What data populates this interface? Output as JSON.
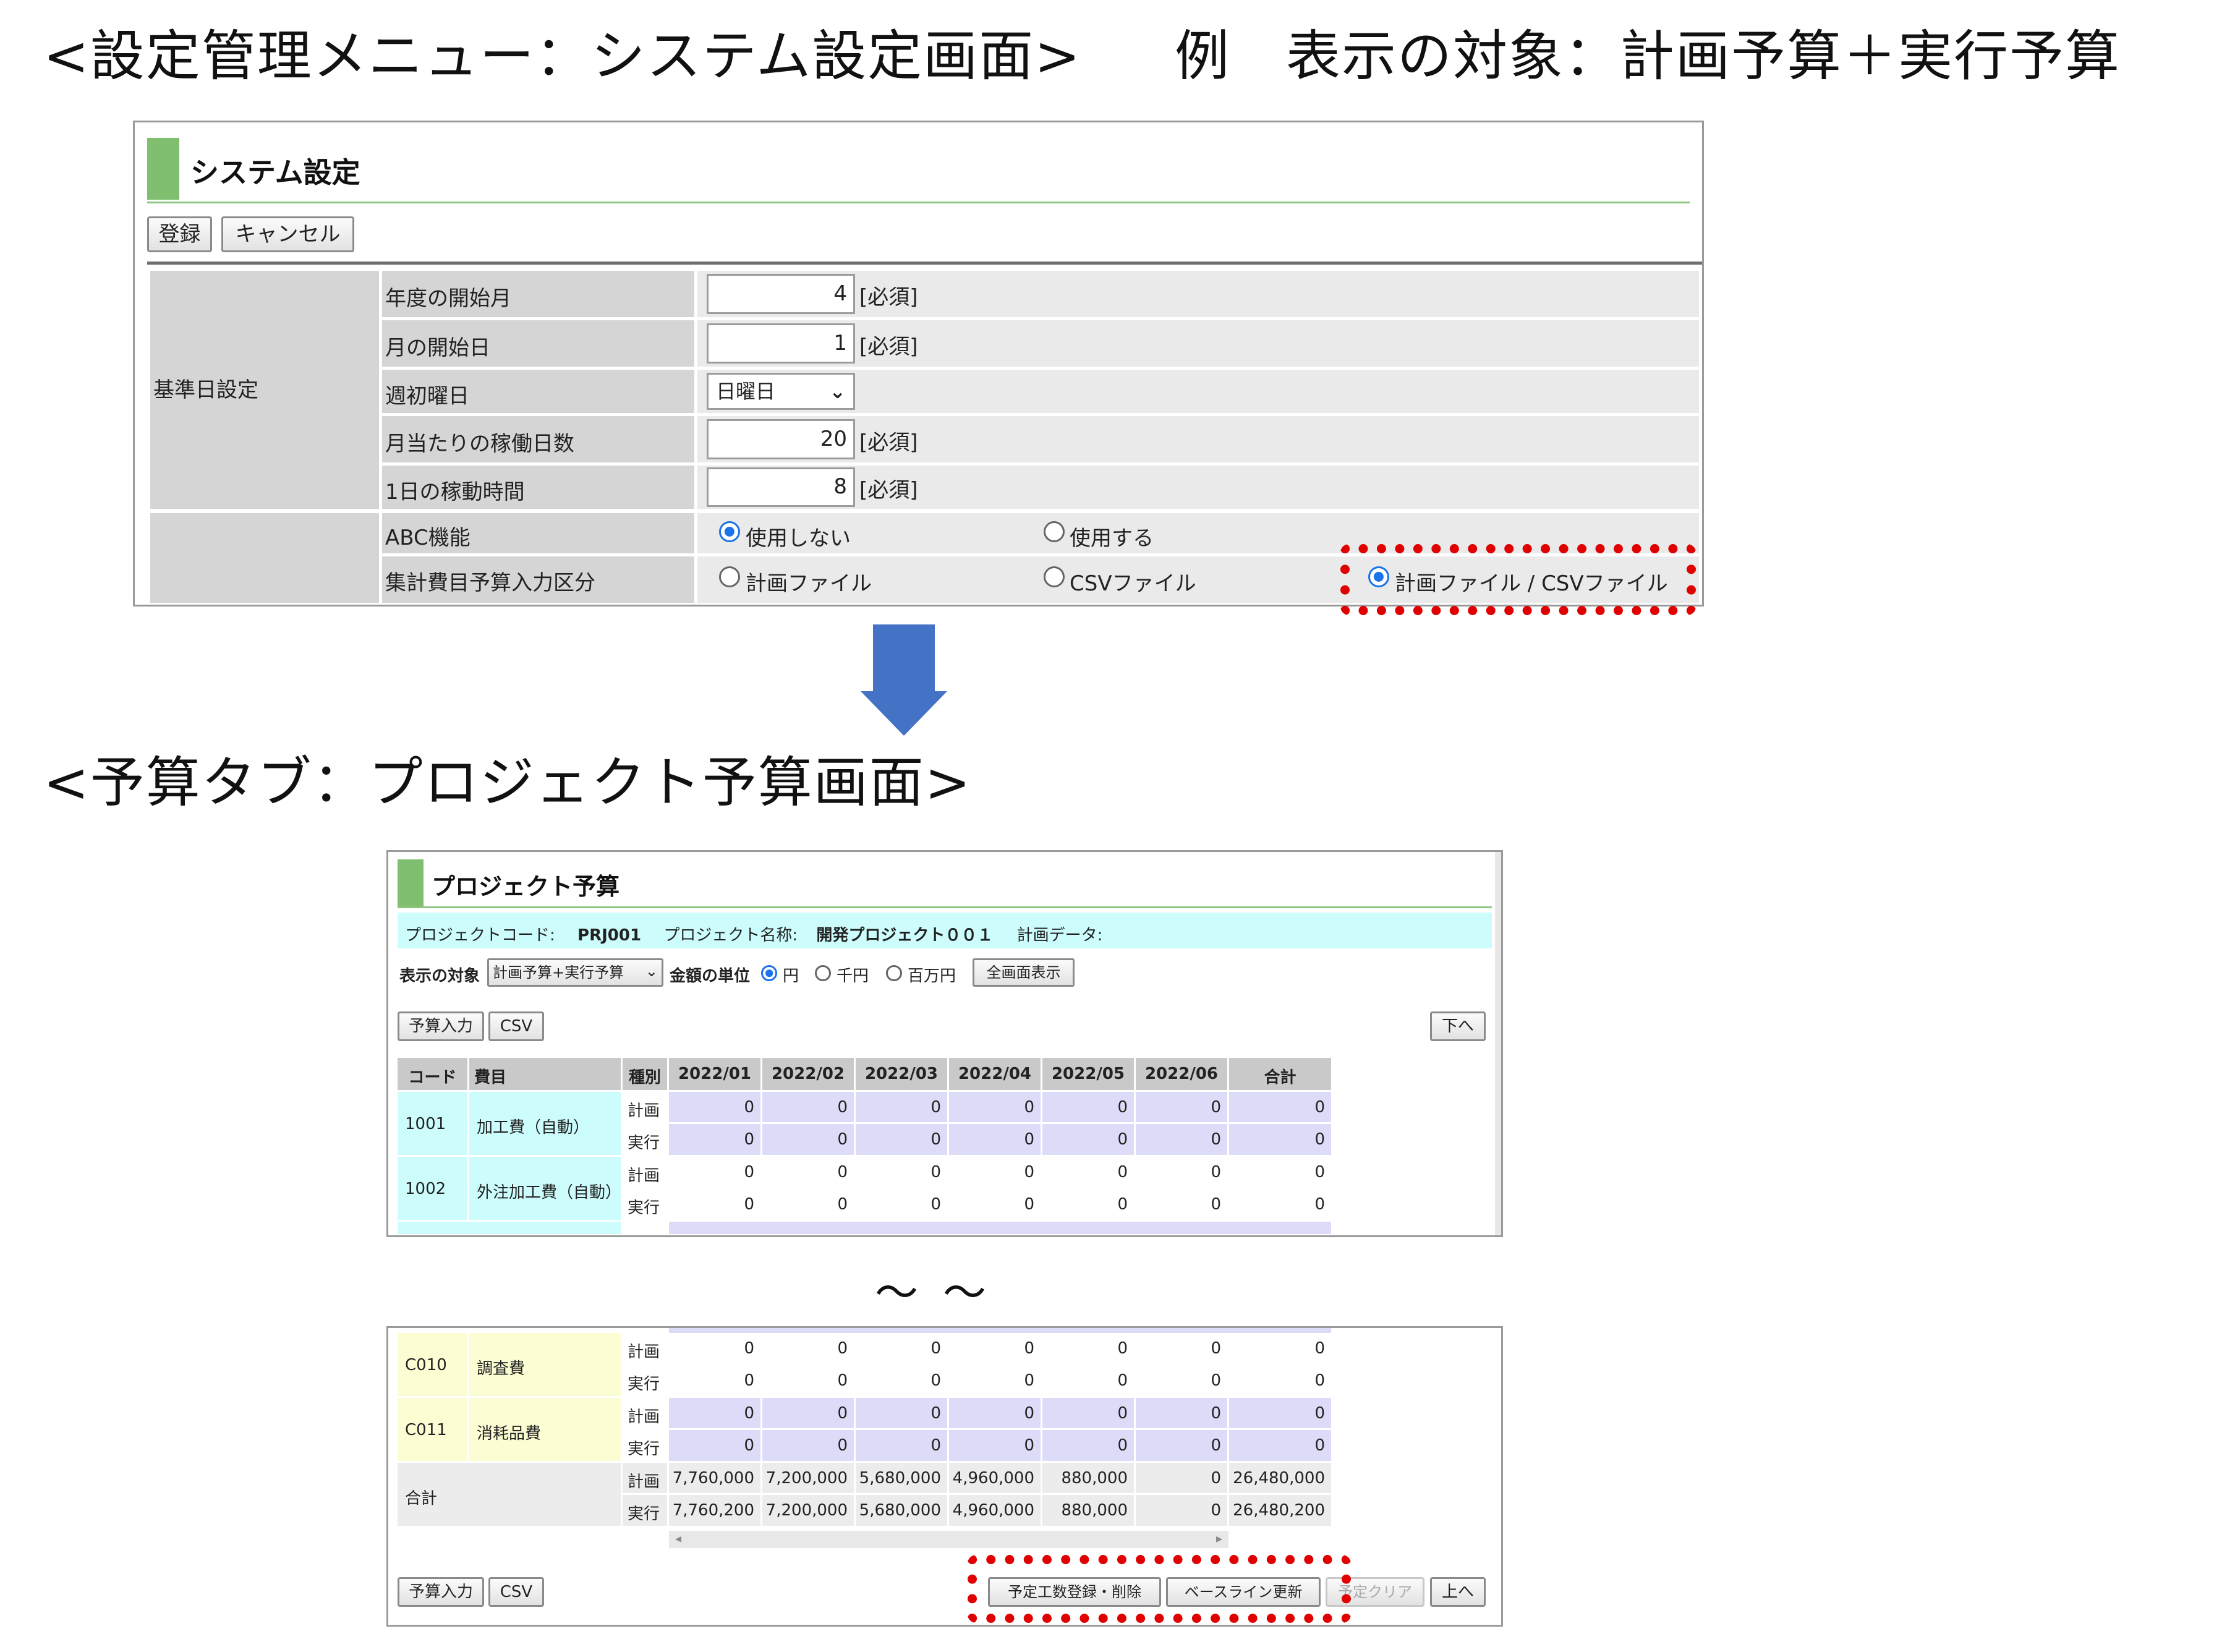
{
  "headings": {
    "system_section": "<設定管理メニュー：システム設定画面>",
    "example": "例　表示の対象：計画予算＋実行予算",
    "budget_section": "<予算タブ：プロジェクト予算画面>"
  },
  "system_settings": {
    "title": "システム設定",
    "buttons": {
      "register": "登録",
      "cancel": "キャンセル"
    },
    "group_label": "基準日設定",
    "required_mark": "[必須]",
    "rows": [
      {
        "label": "年度の開始月",
        "value": "4"
      },
      {
        "label": "月の開始日",
        "value": "1"
      },
      {
        "label": "週初曜日",
        "value": "日曜日"
      },
      {
        "label": "月当たりの稼働日数",
        "value": "20"
      },
      {
        "label": "1日の稼動時間",
        "value": "8"
      }
    ],
    "abc": {
      "label": "ABC機能",
      "options": [
        "使用しない",
        "使用する"
      ],
      "selected": "使用しない"
    },
    "budget_input": {
      "label": "集計費目予算入力区分",
      "options": [
        "計画ファイル",
        "CSVファイル",
        "計画ファイル / CSVファイル"
      ],
      "selected": "計画ファイル / CSVファイル"
    },
    "highlight_color": "#e00000",
    "accent_color": "#7fbf6f"
  },
  "project_budget": {
    "title": "プロジェクト予算",
    "info": {
      "code_label": "プロジェクトコード:",
      "code_value": "PRJ001",
      "name_label": "プロジェクト名称:",
      "name_value": "開発プロジェクト００１",
      "plan_label": "計画データ:"
    },
    "display_label": "表示の対象",
    "display_value": "計画予算+実行予算",
    "unit_label": "金額の単位",
    "units": [
      "円",
      "千円",
      "百万円"
    ],
    "unit_selected": "円",
    "fullscreen_button": "全画面表示",
    "buttons_top": {
      "budget_input": "予算入力",
      "csv": "CSV",
      "down": "下へ"
    },
    "buttons_bottom": {
      "budget_input": "予算入力",
      "csv": "CSV",
      "estimate": "予定工数登録・削除",
      "baseline": "ベースライン更新",
      "clear": "予定クリア",
      "up": "上へ"
    },
    "columns": [
      "コード",
      "費目",
      "種別",
      "2022/01",
      "2022/02",
      "2022/03",
      "2022/04",
      "2022/05",
      "2022/06",
      "合計"
    ],
    "plan_label": "計画",
    "actual_label": "実行",
    "top_rows": [
      {
        "code": "1001",
        "name": "加工費（自動）",
        "plan": [
          "0",
          "0",
          "0",
          "0",
          "0",
          "0",
          "0"
        ],
        "actual": [
          "0",
          "0",
          "0",
          "0",
          "0",
          "0",
          "0"
        ]
      },
      {
        "code": "1002",
        "name": "外注加工費（自動）",
        "plan": [
          "0",
          "0",
          "0",
          "0",
          "0",
          "0",
          "0"
        ],
        "actual": [
          "0",
          "0",
          "0",
          "0",
          "0",
          "0",
          "0"
        ]
      }
    ],
    "bottom_rows": [
      {
        "code": "C010",
        "name": "調査費",
        "plan": [
          "0",
          "0",
          "0",
          "0",
          "0",
          "0",
          "0"
        ],
        "actual": [
          "0",
          "0",
          "0",
          "0",
          "0",
          "0",
          "0"
        ]
      },
      {
        "code": "C011",
        "name": "消耗品費",
        "plan": [
          "0",
          "0",
          "0",
          "0",
          "0",
          "0",
          "0"
        ],
        "actual": [
          "0",
          "0",
          "0",
          "0",
          "0",
          "0",
          "0"
        ]
      }
    ],
    "total": {
      "label": "合計",
      "plan": [
        "7,760,000",
        "7,200,000",
        "5,680,000",
        "4,960,000",
        "880,000",
        "0",
        "26,480,000"
      ],
      "actual": [
        "7,760,200",
        "7,200,000",
        "5,680,000",
        "4,960,000",
        "880,000",
        "0",
        "26,480,200"
      ]
    }
  },
  "break_mark": "〜〜",
  "arrow_color": "#4472c4"
}
